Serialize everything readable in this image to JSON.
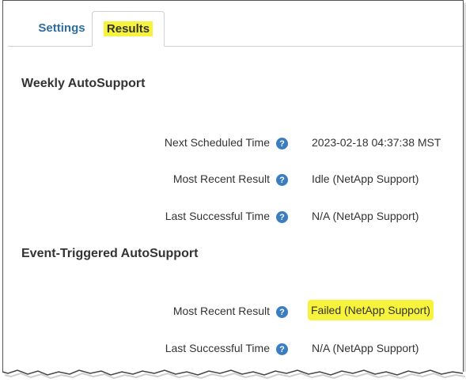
{
  "tabs": {
    "settings": "Settings",
    "results": "Results"
  },
  "weekly": {
    "title": "Weekly AutoSupport",
    "rows": [
      {
        "label": "Next Scheduled Time",
        "value": "2023-02-18 04:37:38 MST"
      },
      {
        "label": "Most Recent Result",
        "value": "Idle (NetApp Support)"
      },
      {
        "label": "Last Successful Time",
        "value": "N/A (NetApp Support)"
      }
    ]
  },
  "event": {
    "title": "Event-Triggered AutoSupport",
    "rows": [
      {
        "label": "Most Recent Result",
        "value": "Failed (NetApp Support)"
      },
      {
        "label": "Last Successful Time",
        "value": "N/A (NetApp Support)"
      }
    ]
  },
  "help_glyph": "?",
  "colors": {
    "highlight": "#f7f23c",
    "tab_link": "#2d6e9e",
    "help_icon": "#3a7dc0"
  }
}
